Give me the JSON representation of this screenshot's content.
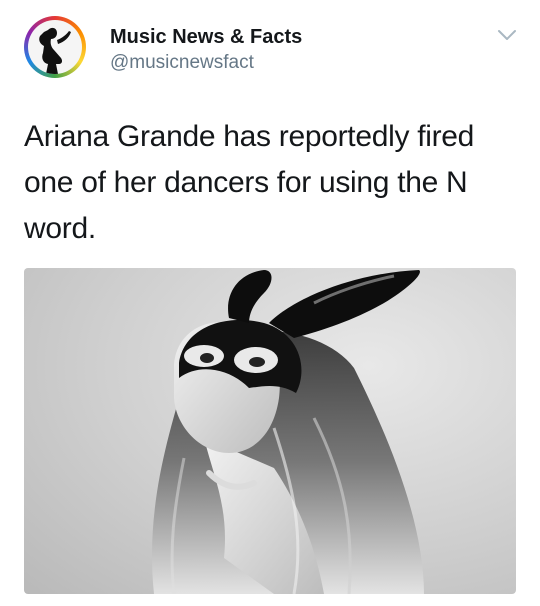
{
  "tweet": {
    "display_name": "Music News & Facts",
    "handle": "@musicnewsfact",
    "text": "Ariana Grande has reportedly fired one of her dancers for using the N word.",
    "media": {
      "type": "photo",
      "tone": "black-and-white"
    }
  },
  "icons": {
    "avatar": "dancer-silhouette-avatar",
    "menu": "chevron-down-icon"
  },
  "colors": {
    "text_primary": "#14171a",
    "text_secondary": "#657786",
    "chevron": "#aab8c2"
  }
}
